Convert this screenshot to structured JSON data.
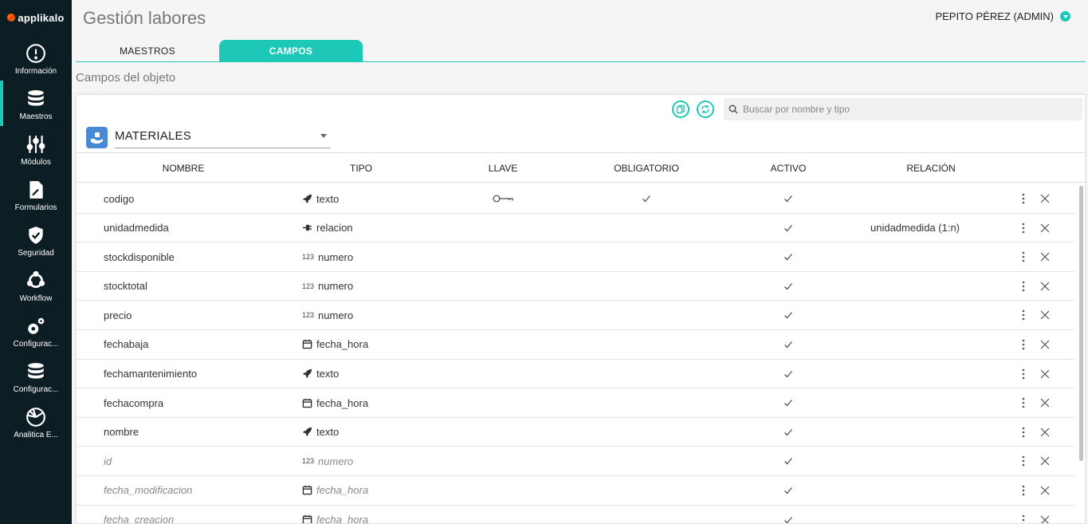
{
  "app": {
    "brand": "applikalo",
    "title": "Gestión labores"
  },
  "user": {
    "name": "PEPITO PÉREZ (ADMIN)"
  },
  "sidebar": {
    "items": [
      {
        "label": "Información",
        "icon": "alert-circle-icon"
      },
      {
        "label": "Maestros",
        "icon": "database-icon"
      },
      {
        "label": "Módulos",
        "icon": "sliders-icon"
      },
      {
        "label": "Formularios",
        "icon": "form-icon"
      },
      {
        "label": "Seguridad",
        "icon": "shield-check-icon"
      },
      {
        "label": "Workflow",
        "icon": "workflow-icon"
      },
      {
        "label": "Configurac...",
        "icon": "gears-icon"
      },
      {
        "label": "Configurac...",
        "icon": "database-icon"
      },
      {
        "label": "Analitica E...",
        "icon": "pie-chart-icon"
      }
    ],
    "active": "Maestros"
  },
  "tabs": {
    "maestros": "MAESTROS",
    "campos": "CAMPOS",
    "active": "CAMPOS"
  },
  "section_title": "Campos del objeto",
  "search": {
    "placeholder": "Buscar por nombre y tipo",
    "value": ""
  },
  "object": {
    "selected": "MATERIALES",
    "icon": "object-icon"
  },
  "table": {
    "headers": {
      "nombre": "NOMBRE",
      "tipo": "TIPO",
      "llave": "LLAVE",
      "obligatorio": "OBLIGATORIO",
      "activo": "ACTIVO",
      "relacion": "RELACIÓN"
    },
    "rows": [
      {
        "nombre": "codigo",
        "tipo": "texto",
        "tipo_icon": "rocket-icon",
        "llave": true,
        "obligatorio": true,
        "activo": true,
        "relacion": "",
        "system": false
      },
      {
        "nombre": "unidadmedida",
        "tipo": "relacion",
        "tipo_icon": "plug-icon",
        "llave": false,
        "obligatorio": false,
        "activo": true,
        "relacion": "unidadmedida (1:n)",
        "system": false
      },
      {
        "nombre": "stockdisponible",
        "tipo": "numero",
        "tipo_icon": "number-icon",
        "llave": false,
        "obligatorio": false,
        "activo": true,
        "relacion": "",
        "system": false
      },
      {
        "nombre": "stocktotal",
        "tipo": "numero",
        "tipo_icon": "number-icon",
        "llave": false,
        "obligatorio": false,
        "activo": true,
        "relacion": "",
        "system": false
      },
      {
        "nombre": "precio",
        "tipo": "numero",
        "tipo_icon": "number-icon",
        "llave": false,
        "obligatorio": false,
        "activo": true,
        "relacion": "",
        "system": false
      },
      {
        "nombre": "fechabaja",
        "tipo": "fecha_hora",
        "tipo_icon": "calendar-icon",
        "llave": false,
        "obligatorio": false,
        "activo": true,
        "relacion": "",
        "system": false
      },
      {
        "nombre": "fechamantenimiento",
        "tipo": "texto",
        "tipo_icon": "rocket-icon",
        "llave": false,
        "obligatorio": false,
        "activo": true,
        "relacion": "",
        "system": false
      },
      {
        "nombre": "fechacompra",
        "tipo": "fecha_hora",
        "tipo_icon": "calendar-icon",
        "llave": false,
        "obligatorio": false,
        "activo": true,
        "relacion": "",
        "system": false
      },
      {
        "nombre": "nombre",
        "tipo": "texto",
        "tipo_icon": "rocket-icon",
        "llave": false,
        "obligatorio": false,
        "activo": true,
        "relacion": "",
        "system": false
      },
      {
        "nombre": "id",
        "tipo": "numero",
        "tipo_icon": "number-icon",
        "llave": false,
        "obligatorio": false,
        "activo": true,
        "relacion": "",
        "system": true
      },
      {
        "nombre": "fecha_modificacion",
        "tipo": "fecha_hora",
        "tipo_icon": "calendar-icon",
        "llave": false,
        "obligatorio": false,
        "activo": true,
        "relacion": "",
        "system": true
      },
      {
        "nombre": "fecha_creacion",
        "tipo": "fecha_hora",
        "tipo_icon": "calendar-icon",
        "llave": false,
        "obligatorio": false,
        "activo": true,
        "relacion": "",
        "system": true
      }
    ]
  },
  "number_icon_text": "123",
  "colors": {
    "accent": "#1ec8b8",
    "sidebar_bg": "#0d1d24",
    "object_icon_bg": "#4a8ad4"
  }
}
